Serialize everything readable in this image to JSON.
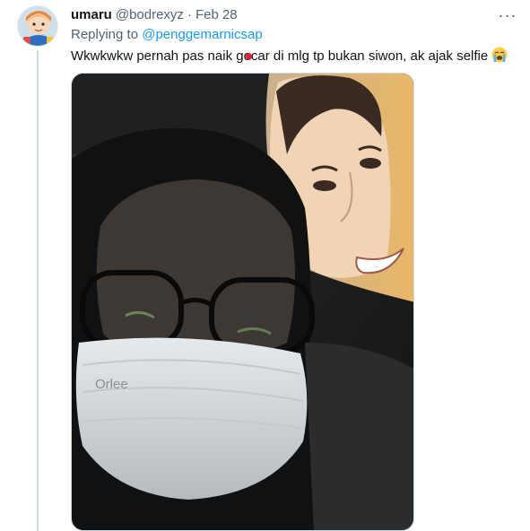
{
  "tweet": {
    "display_name": "umaru",
    "handle": "@bodrexyz",
    "separator": "·",
    "date": "Feb 28",
    "reply_prefix": "Replying to",
    "reply_mention": "@penggemarnicsap",
    "text": "Wkwkwkw pernah pas naik gocar di mlg tp bukan siwon, ak ajak selfie",
    "emoji": "loudly-crying-face",
    "more_glyph": "···"
  },
  "media": {
    "mask_print": "Orlee"
  },
  "colors": {
    "link": "#1d9bf0",
    "secondary_text": "#536471",
    "primary_text": "#0f1419",
    "thread_line": "#cfd9de"
  }
}
